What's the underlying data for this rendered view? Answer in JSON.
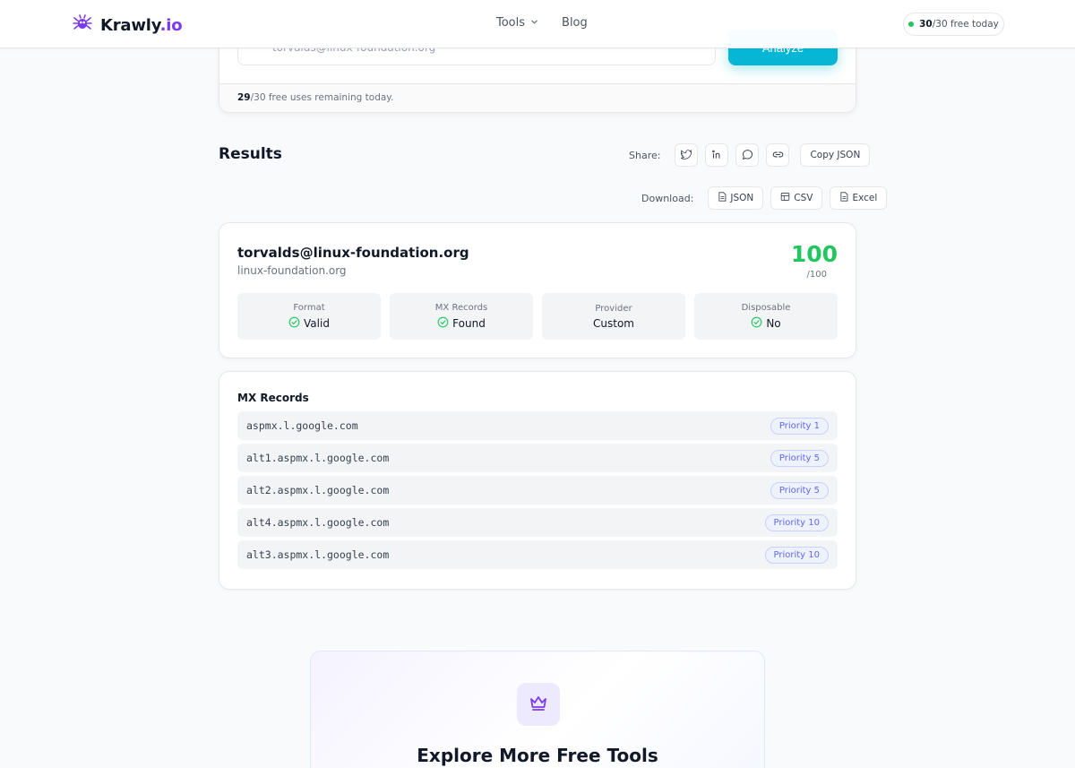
{
  "header": {
    "logo_name": "Krawly",
    "logo_tld": ".io",
    "nav": [
      {
        "label": "Tools"
      },
      {
        "label": "Blog"
      }
    ],
    "credits": {
      "used": "30",
      "suffix": "/30 free today"
    }
  },
  "search": {
    "input_value": "torvalds@linux-foundation.org",
    "button_label": "Analyze",
    "remaining_count": "29",
    "remaining_suffix": "/30 free uses remaining today."
  },
  "results": {
    "title": "Results",
    "share_label": "Share:",
    "copy_json_label": "Copy JSON",
    "download_label": "Download:",
    "download_buttons": [
      "JSON",
      "CSV",
      "Excel"
    ]
  },
  "email": {
    "address": "torvalds@linux-foundation.org",
    "domain": "linux-foundation.org",
    "score": "100",
    "score_max": "/100",
    "stats": [
      {
        "label": "Format",
        "value": "Valid",
        "check": true
      },
      {
        "label": "MX Records",
        "value": "Found",
        "check": true
      },
      {
        "label": "Provider",
        "value": "Custom",
        "check": false
      },
      {
        "label": "Disposable",
        "value": "No",
        "check": true
      }
    ]
  },
  "mx": {
    "title": "MX Records",
    "records": [
      {
        "host": "aspmx.l.google.com",
        "priority": "Priority 1"
      },
      {
        "host": "alt1.aspmx.l.google.com",
        "priority": "Priority 5"
      },
      {
        "host": "alt2.aspmx.l.google.com",
        "priority": "Priority 5"
      },
      {
        "host": "alt4.aspmx.l.google.com",
        "priority": "Priority 10"
      },
      {
        "host": "alt3.aspmx.l.google.com",
        "priority": "Priority 10"
      }
    ]
  },
  "promo": {
    "title": "Explore More Free Tools"
  },
  "colors": {
    "brand": "#7c3aed",
    "accent": "#06b6d4",
    "success": "#22c55e",
    "badge": "#6366f1"
  },
  "icons": [
    "spider-logo-icon",
    "chevron-down-icon",
    "mail-icon",
    "twitter-icon",
    "linkedin-icon",
    "chat-icon",
    "link-icon",
    "file-icon",
    "table-icon",
    "check-circle-icon",
    "crown-icon"
  ]
}
